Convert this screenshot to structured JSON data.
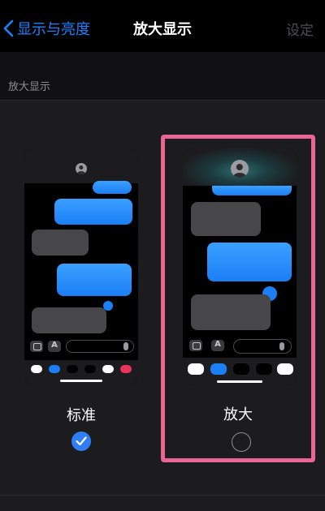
{
  "nav": {
    "back_label": "显示与亮度",
    "title": "放大显示",
    "action_label": "设定"
  },
  "section": {
    "header": "放大显示"
  },
  "options": [
    {
      "label": "标准",
      "selected": true
    },
    {
      "label": "放大",
      "selected": false
    }
  ],
  "colors": {
    "accent": "#1a82ff",
    "highlight_border": "#e8668f",
    "bubble_blue": "#1b7ff5",
    "bubble_grey": "#47474a"
  },
  "icons": [
    "chevron-left-icon",
    "avatar-icon",
    "camera-icon",
    "appstore-icon",
    "mic-icon",
    "checkmark-icon"
  ]
}
